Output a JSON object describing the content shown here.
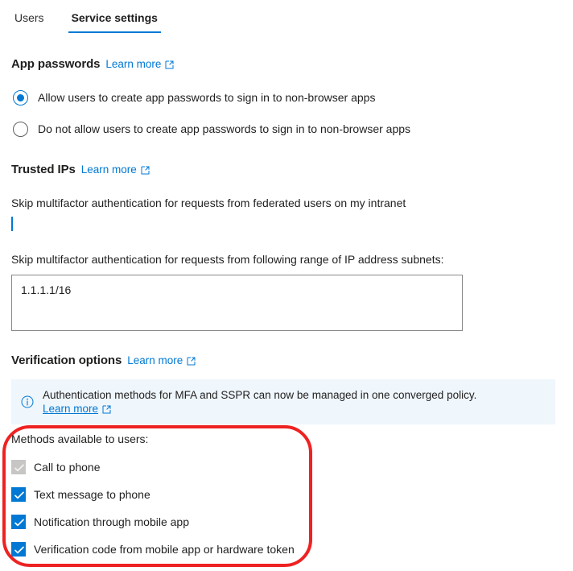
{
  "tabs": [
    {
      "label": "Users",
      "active": false
    },
    {
      "label": "Service settings",
      "active": true
    }
  ],
  "app_passwords": {
    "title": "App passwords",
    "learn_more": "Learn more",
    "options": [
      {
        "label": "Allow users to create app passwords to sign in to non-browser apps",
        "selected": true
      },
      {
        "label": "Do not allow users to create app passwords to sign in to non-browser apps",
        "selected": false
      }
    ]
  },
  "trusted_ips": {
    "title": "Trusted IPs",
    "learn_more": "Learn more",
    "federated_label": "Skip multifactor authentication for requests from federated users on my intranet",
    "federated_checked": true,
    "subnets_label": "Skip multifactor authentication for requests from following range of IP address subnets:",
    "subnets_value": "1.1.1.1/16",
    "subnets_placeholder": ""
  },
  "verification_options": {
    "title": "Verification options",
    "learn_more": "Learn more",
    "banner": {
      "text": "Authentication methods for MFA and SSPR can now be managed in one converged policy.",
      "link": "Learn more"
    },
    "methods_label": "Methods available to users:",
    "methods": [
      {
        "label": "Call to phone",
        "checked": true,
        "disabled": true
      },
      {
        "label": "Text message to phone",
        "checked": true,
        "disabled": false
      },
      {
        "label": "Notification through mobile app",
        "checked": true,
        "disabled": false
      },
      {
        "label": "Verification code from mobile app or hardware token",
        "checked": true,
        "disabled": false
      }
    ]
  },
  "colors": {
    "accent": "#0078d4",
    "highlight": "#ee2222",
    "banner_bg": "#eff6fc",
    "disabled_checkbox": "#c8c6c4"
  }
}
